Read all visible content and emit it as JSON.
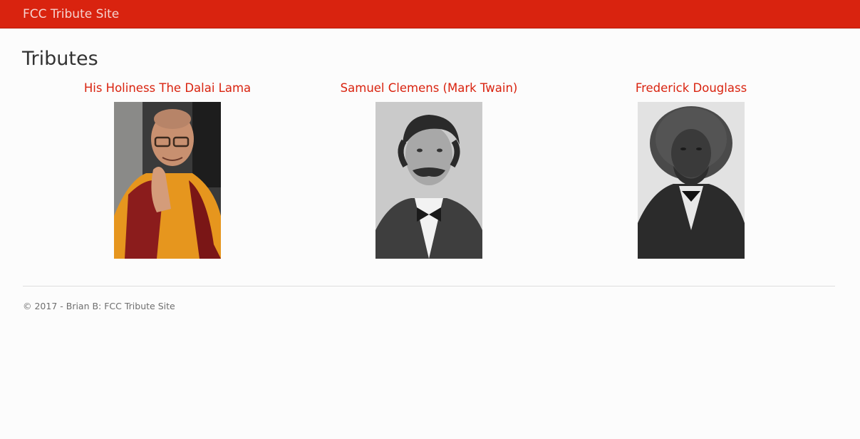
{
  "navbar": {
    "brand": "FCC Tribute Site"
  },
  "main": {
    "title": "Tributes",
    "tributes": [
      {
        "name": "His Holiness The Dalai Lama"
      },
      {
        "name": "Samuel Clemens (Mark Twain)"
      },
      {
        "name": "Frederick Douglass"
      }
    ]
  },
  "footer": {
    "text": "© 2017 - Brian B: FCC Tribute Site"
  },
  "colors": {
    "brand": "#d9230f",
    "background": "#fcfcfc",
    "text": "#333333"
  }
}
